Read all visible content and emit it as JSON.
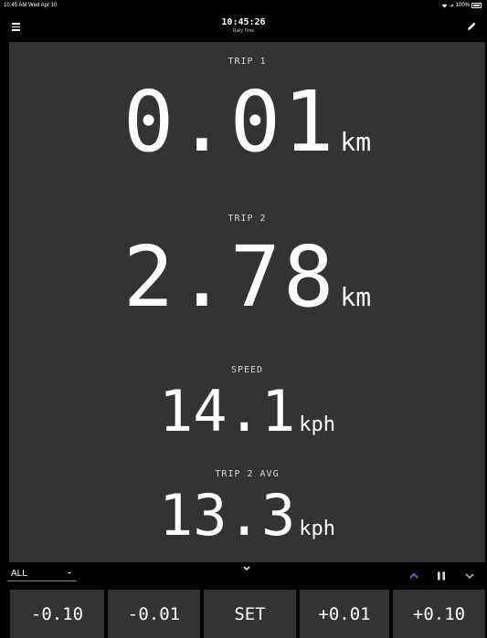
{
  "status": {
    "time": "10:45 AM  Wed Apr 10",
    "battery": "100%"
  },
  "header": {
    "clock": "10:45:26",
    "subtitle": "Rally Time"
  },
  "trip1": {
    "label": "TRIP 1",
    "value": "0.01",
    "unit": "km"
  },
  "trip2": {
    "label": "TRIP 2",
    "value": "2.78",
    "unit": "km"
  },
  "speed": {
    "label": "SPEED",
    "value": "14.1",
    "unit": "kph"
  },
  "trip2avg": {
    "label": "TRIP 2 AVG",
    "value": "13.3",
    "unit": "kph"
  },
  "selector": {
    "value": "ALL"
  },
  "buttons": [
    "-0.10",
    "-0.01",
    "SET",
    "+0.01",
    "+0.10"
  ],
  "colors": {
    "background": "#000000",
    "panel": "#333333",
    "accent": "#4a6cf7"
  }
}
